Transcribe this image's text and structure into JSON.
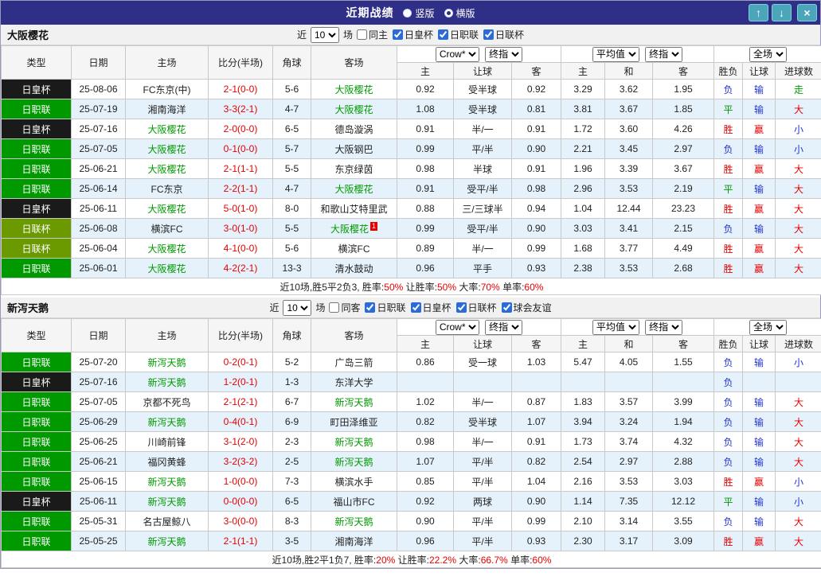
{
  "titlebar": {
    "title": "近期战绩",
    "vertical_label": "竖版",
    "horizontal_label": "横版",
    "selected_layout": "横版",
    "up_icon": "↑",
    "down_icon": "↓",
    "close_icon": "×"
  },
  "labels": {
    "near": "近",
    "games": "场"
  },
  "columns": {
    "type": "类型",
    "date": "日期",
    "home": "主场",
    "score": "比分(半场)",
    "corner": "角球",
    "away": "客场",
    "h_home": "主",
    "handicap": "让球",
    "h_away": "客",
    "a_home": "主",
    "a_draw": "和",
    "a_away": "客",
    "result": "胜负",
    "let": "让球",
    "goals": "进球数"
  },
  "colors": {
    "titlebar_bg": "#2f2f87",
    "button_teal": "#4aa6b8",
    "row_alt": "#e6f2fb",
    "team_highlight": "#009a00",
    "score_red": "#e60000",
    "league": {
      "日职联": "#009a00",
      "日皇杯": "#1a1a1a",
      "日联杯": "#6b9a00"
    },
    "outcome": {
      "胜": "#e60000",
      "赢": "#e60000",
      "大": "#e60000",
      "平": "#009a00",
      "走": "#009a00",
      "负": "#2233cc",
      "输": "#2233cc",
      "小": "#2233cc"
    }
  },
  "sections": [
    {
      "team": "大阪樱花",
      "filter": {
        "count": "10",
        "checkboxes": [
          {
            "label": "同主",
            "checked": false
          },
          {
            "label": "日皇杯",
            "checked": true
          },
          {
            "label": "日职联",
            "checked": true
          },
          {
            "label": "日联杯",
            "checked": true
          }
        ]
      },
      "selects": {
        "company": "Crow*",
        "company_time": "终指",
        "average": "平均值",
        "average_time": "终指",
        "scope": "全场"
      },
      "rows": [
        {
          "type": "日皇杯",
          "date": "25-08-06",
          "home": "FC东京(中)",
          "score": "2-1(0-0)",
          "corner": "5-6",
          "away": "大阪樱花",
          "o1": "0.92",
          "o2": "受半球",
          "o3": "0.92",
          "a1": "3.29",
          "a2": "3.62",
          "a3": "1.95",
          "r1": "负",
          "r2": "输",
          "r3": "走"
        },
        {
          "type": "日职联",
          "date": "25-07-19",
          "home": "湘南海洋",
          "score": "3-3(2-1)",
          "corner": "4-7",
          "away": "大阪樱花",
          "o1": "1.08",
          "o2": "受半球",
          "o3": "0.81",
          "a1": "3.81",
          "a2": "3.67",
          "a3": "1.85",
          "r1": "平",
          "r2": "输",
          "r3": "大"
        },
        {
          "type": "日皇杯",
          "date": "25-07-16",
          "home": "大阪樱花",
          "score": "2-0(0-0)",
          "corner": "6-5",
          "away": "德岛漩涡",
          "o1": "0.91",
          "o2": "半/一",
          "o3": "0.91",
          "a1": "1.72",
          "a2": "3.60",
          "a3": "4.26",
          "r1": "胜",
          "r2": "赢",
          "r3": "小"
        },
        {
          "type": "日职联",
          "date": "25-07-05",
          "home": "大阪樱花",
          "score": "0-1(0-0)",
          "corner": "5-7",
          "away": "大阪钢巴",
          "o1": "0.99",
          "o2": "平/半",
          "o3": "0.90",
          "a1": "2.21",
          "a2": "3.45",
          "a3": "2.97",
          "r1": "负",
          "r2": "输",
          "r3": "小"
        },
        {
          "type": "日职联",
          "date": "25-06-21",
          "home": "大阪樱花",
          "score": "2-1(1-1)",
          "corner": "5-5",
          "away": "东京绿茵",
          "o1": "0.98",
          "o2": "半球",
          "o3": "0.91",
          "a1": "1.96",
          "a2": "3.39",
          "a3": "3.67",
          "r1": "胜",
          "r2": "赢",
          "r3": "大"
        },
        {
          "type": "日职联",
          "date": "25-06-14",
          "home": "FC东京",
          "score": "2-2(1-1)",
          "corner": "4-7",
          "away": "大阪樱花",
          "o1": "0.91",
          "o2": "受平/半",
          "o3": "0.98",
          "a1": "2.96",
          "a2": "3.53",
          "a3": "2.19",
          "r1": "平",
          "r2": "输",
          "r3": "大"
        },
        {
          "type": "日皇杯",
          "date": "25-06-11",
          "home": "大阪樱花",
          "score": "5-0(1-0)",
          "corner": "8-0",
          "away": "和歌山艾特里武",
          "o1": "0.88",
          "o2": "三/三球半",
          "o3": "0.94",
          "a1": "1.04",
          "a2": "12.44",
          "a3": "23.23",
          "r1": "胜",
          "r2": "赢",
          "r3": "大"
        },
        {
          "type": "日联杯",
          "date": "25-06-08",
          "home": "横滨FC",
          "score": "3-0(1-0)",
          "corner": "5-5",
          "away": "大阪樱花",
          "red_card": "1",
          "o1": "0.99",
          "o2": "受平/半",
          "o3": "0.90",
          "a1": "3.03",
          "a2": "3.41",
          "a3": "2.15",
          "r1": "负",
          "r2": "输",
          "r3": "大"
        },
        {
          "type": "日联杯",
          "date": "25-06-04",
          "home": "大阪樱花",
          "score": "4-1(0-0)",
          "corner": "5-6",
          "away": "横滨FC",
          "o1": "0.89",
          "o2": "半/一",
          "o3": "0.99",
          "a1": "1.68",
          "a2": "3.77",
          "a3": "4.49",
          "r1": "胜",
          "r2": "赢",
          "r3": "大"
        },
        {
          "type": "日职联",
          "date": "25-06-01",
          "home": "大阪樱花",
          "score": "4-2(2-1)",
          "corner": "13-3",
          "away": "清水鼓动",
          "o1": "0.96",
          "o2": "平手",
          "o3": "0.93",
          "a1": "2.38",
          "a2": "3.53",
          "a3": "2.68",
          "r1": "胜",
          "r2": "赢",
          "r3": "大"
        }
      ],
      "summary": {
        "p1": "近10场,胜5平2负3, 胜率:",
        "v1": "50%",
        "p2": "让胜率:",
        "v2": "50%",
        "p3": "大率:",
        "v3": "70%",
        "p4": "单率:",
        "v4": "60%"
      }
    },
    {
      "team": "新泻天鹅",
      "filter": {
        "count": "10",
        "checkboxes": [
          {
            "label": "同客",
            "checked": false
          },
          {
            "label": "日职联",
            "checked": true
          },
          {
            "label": "日皇杯",
            "checked": true
          },
          {
            "label": "日联杯",
            "checked": true
          },
          {
            "label": "球会友谊",
            "checked": true
          }
        ]
      },
      "selects": {
        "company": "Crow*",
        "company_time": "终指",
        "average": "平均值",
        "average_time": "终指",
        "scope": "全场"
      },
      "rows": [
        {
          "type": "日职联",
          "date": "25-07-20",
          "home": "新泻天鹅",
          "score": "0-2(0-1)",
          "corner": "5-2",
          "away": "广岛三箭",
          "o1": "0.86",
          "o2": "受一球",
          "o3": "1.03",
          "a1": "5.47",
          "a2": "4.05",
          "a3": "1.55",
          "r1": "负",
          "r2": "输",
          "r3": "小"
        },
        {
          "type": "日皇杯",
          "date": "25-07-16",
          "home": "新泻天鹅",
          "score": "1-2(0-1)",
          "corner": "1-3",
          "away": "东洋大学",
          "o1": "",
          "o2": "",
          "o3": "",
          "a1": "",
          "a2": "",
          "a3": "",
          "r1": "负",
          "r2": "",
          "r3": ""
        },
        {
          "type": "日职联",
          "date": "25-07-05",
          "home": "京都不死鸟",
          "score": "2-1(2-1)",
          "corner": "6-7",
          "away": "新泻天鹅",
          "o1": "1.02",
          "o2": "半/一",
          "o3": "0.87",
          "a1": "1.83",
          "a2": "3.57",
          "a3": "3.99",
          "r1": "负",
          "r2": "输",
          "r3": "大"
        },
        {
          "type": "日职联",
          "date": "25-06-29",
          "home": "新泻天鹅",
          "score": "0-4(0-1)",
          "corner": "6-9",
          "away": "町田泽维亚",
          "o1": "0.82",
          "o2": "受半球",
          "o3": "1.07",
          "a1": "3.94",
          "a2": "3.24",
          "a3": "1.94",
          "r1": "负",
          "r2": "输",
          "r3": "大"
        },
        {
          "type": "日职联",
          "date": "25-06-25",
          "home": "川崎前锋",
          "score": "3-1(2-0)",
          "corner": "2-3",
          "away": "新泻天鹅",
          "o1": "0.98",
          "o2": "半/一",
          "o3": "0.91",
          "a1": "1.73",
          "a2": "3.74",
          "a3": "4.32",
          "r1": "负",
          "r2": "输",
          "r3": "大"
        },
        {
          "type": "日职联",
          "date": "25-06-21",
          "home": "福冈黄蜂",
          "score": "3-2(3-2)",
          "corner": "2-5",
          "away": "新泻天鹅",
          "o1": "1.07",
          "o2": "平/半",
          "o3": "0.82",
          "a1": "2.54",
          "a2": "2.97",
          "a3": "2.88",
          "r1": "负",
          "r2": "输",
          "r3": "大"
        },
        {
          "type": "日职联",
          "date": "25-06-15",
          "home": "新泻天鹅",
          "score": "1-0(0-0)",
          "corner": "7-3",
          "away": "横滨水手",
          "o1": "0.85",
          "o2": "平/半",
          "o3": "1.04",
          "a1": "2.16",
          "a2": "3.53",
          "a3": "3.03",
          "r1": "胜",
          "r2": "赢",
          "r3": "小"
        },
        {
          "type": "日皇杯",
          "date": "25-06-11",
          "home": "新泻天鹅",
          "score": "0-0(0-0)",
          "corner": "6-5",
          "away": "福山市FC",
          "o1": "0.92",
          "o2": "两球",
          "o3": "0.90",
          "a1": "1.14",
          "a2": "7.35",
          "a3": "12.12",
          "r1": "平",
          "r2": "输",
          "r3": "小"
        },
        {
          "type": "日职联",
          "date": "25-05-31",
          "home": "名古屋鲸八",
          "score": "3-0(0-0)",
          "corner": "8-3",
          "away": "新泻天鹅",
          "o1": "0.90",
          "o2": "平/半",
          "o3": "0.99",
          "a1": "2.10",
          "a2": "3.14",
          "a3": "3.55",
          "r1": "负",
          "r2": "输",
          "r3": "大"
        },
        {
          "type": "日职联",
          "date": "25-05-25",
          "home": "新泻天鹅",
          "score": "2-1(1-1)",
          "corner": "3-5",
          "away": "湘南海洋",
          "o1": "0.96",
          "o2": "平/半",
          "o3": "0.93",
          "a1": "2.30",
          "a2": "3.17",
          "a3": "3.09",
          "r1": "胜",
          "r2": "赢",
          "r3": "大"
        }
      ],
      "summary": {
        "p1": "近10场,胜2平1负7, 胜率:",
        "v1": "20%",
        "p2": "让胜率:",
        "v2": "22.2%",
        "p3": "大率:",
        "v3": "66.7%",
        "p4": "单率:",
        "v4": "60%"
      }
    }
  ]
}
